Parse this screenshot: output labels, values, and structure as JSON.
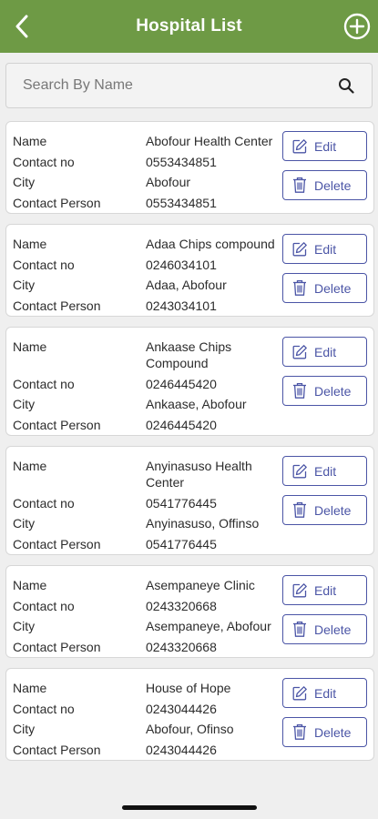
{
  "header": {
    "title": "Hospital List",
    "back_icon": "chevron-left-icon",
    "add_icon": "plus-circle-icon",
    "background": "#6e9a45"
  },
  "search": {
    "placeholder": "Search By Name",
    "value": "",
    "icon": "search-icon"
  },
  "labels": {
    "name": "Name",
    "contact_no": "Contact no",
    "city": "City",
    "contact_person": "Contact Person"
  },
  "buttons": {
    "edit": "Edit",
    "delete": "Delete",
    "edit_icon": "edit-icon",
    "delete_icon": "trash-icon",
    "accent": "#4b55a6"
  },
  "hospitals": [
    {
      "name": "Abofour Health Center",
      "contact_no": "0553434851",
      "city": "Abofour",
      "contact_person": "0553434851"
    },
    {
      "name": "Adaa Chips compound",
      "contact_no": "0246034101",
      "city": "Adaa, Abofour",
      "contact_person": "0243034101"
    },
    {
      "name": "Ankaase Chips Compound",
      "contact_no": "0246445420",
      "city": "Ankaase, Abofour",
      "contact_person": "0246445420"
    },
    {
      "name": "Anyinasuso Health Center",
      "contact_no": "0541776445",
      "city": "Anyinasuso, Offinso",
      "contact_person": "0541776445"
    },
    {
      "name": "Asempaneye Clinic",
      "contact_no": "0243320668",
      "city": "Asempaneye, Abofour",
      "contact_person": "0243320668"
    },
    {
      "name": "House of Hope",
      "contact_no": "0243044426",
      "city": "Abofour, Ofinso",
      "contact_person": "0243044426"
    }
  ]
}
